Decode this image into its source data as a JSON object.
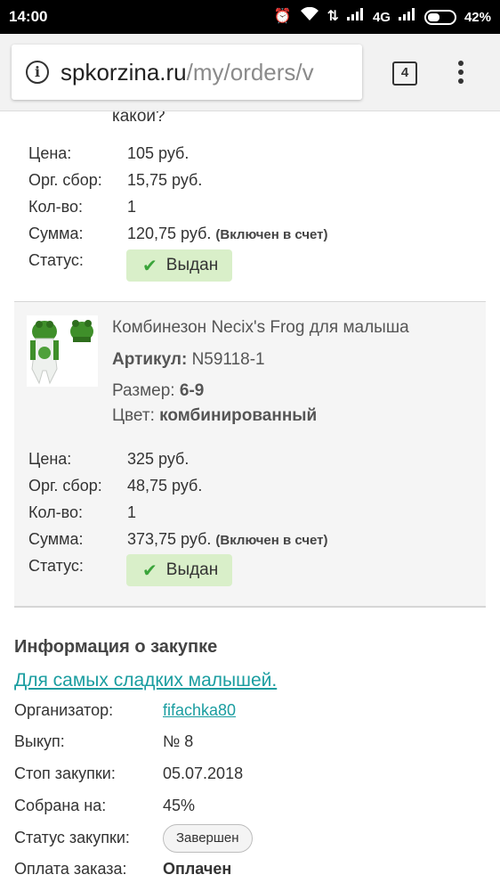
{
  "status_bar": {
    "time": "14:00",
    "network": "4G",
    "battery": "42%"
  },
  "browser": {
    "url_domain": "spkorzina.ru",
    "url_path": "/my/orders/v",
    "tab_count": "4"
  },
  "prev_item": {
    "title_tail": "какой?",
    "rows": [
      {
        "label": "Цена:",
        "value": "105 руб."
      },
      {
        "label": "Орг. сбор:",
        "value": "15,75 руб."
      },
      {
        "label": "Кол-во:",
        "value": "1"
      },
      {
        "label": "Сумма:",
        "value": "120,75 руб.",
        "note": "(Включен в счет)"
      },
      {
        "label": "Статус:"
      }
    ],
    "status": "Выдан"
  },
  "item": {
    "title": "Комбинезон Necix's Frog для малыша",
    "article_label": "Артикул:",
    "article_value": "N59118-1",
    "size_label": "Размер:",
    "size_value": "6-9",
    "color_label": "Цвет:",
    "color_value": "комбинированный",
    "rows": [
      {
        "label": "Цена:",
        "value": "325 руб."
      },
      {
        "label": "Орг. сбор:",
        "value": "48,75 руб."
      },
      {
        "label": "Кол-во:",
        "value": "1"
      },
      {
        "label": "Сумма:",
        "value": "373,75 руб.",
        "note": "(Включен в счет)"
      },
      {
        "label": "Статус:"
      }
    ],
    "status": "Выдан"
  },
  "purchase_info": {
    "title": "Информация о закупке",
    "link_text": "Для самых сладких малышей.",
    "organizer_label": "Организатор:",
    "organizer_value": "fifachka80",
    "buyout_label": "Выкуп:",
    "buyout_value": "№ 8",
    "stop_label": "Стоп закупки:",
    "stop_value": "05.07.2018",
    "collected_label": "Собрана на:",
    "collected_value": "45%",
    "status_label": "Статус закупки:",
    "status_value": "Завершен",
    "payment_label": "Оплата заказа:",
    "payment_value": "Оплачен"
  },
  "colors": {
    "accent_link": "#1a9da0",
    "status_badge_bg": "#d9efc9",
    "check_green": "#3aa43a"
  }
}
